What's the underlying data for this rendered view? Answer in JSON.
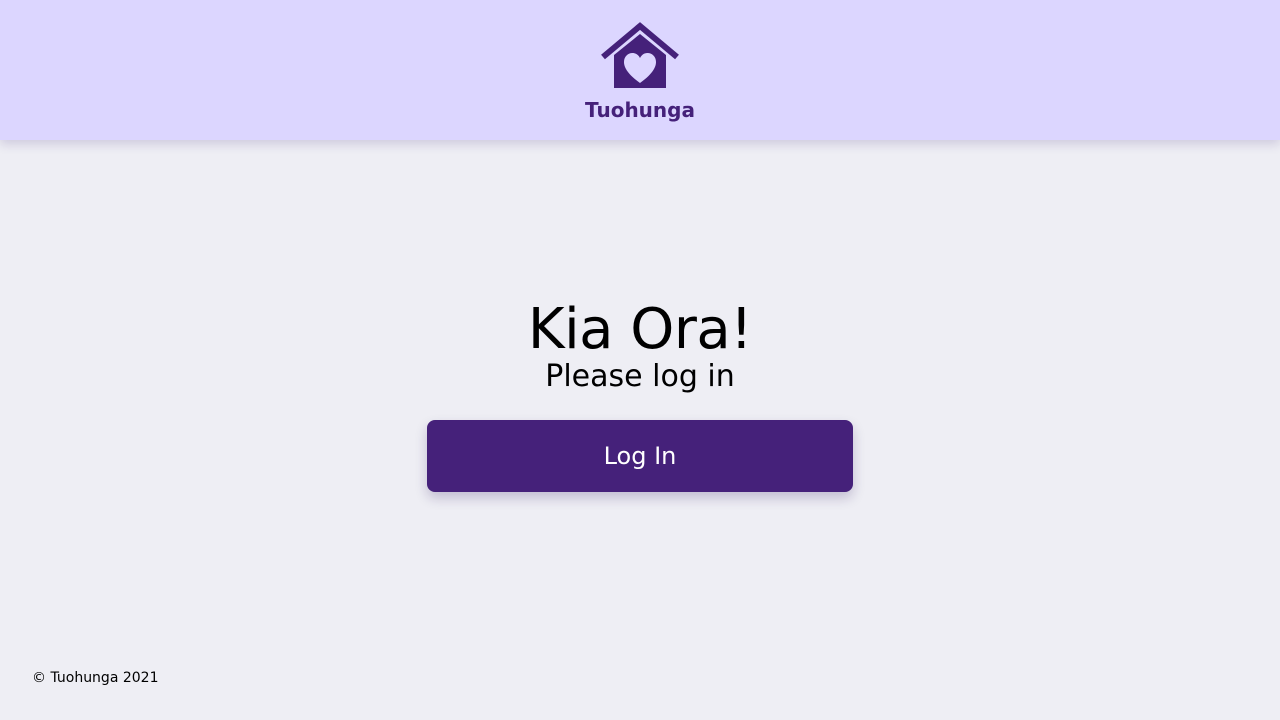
{
  "header": {
    "logo_icon": "house-heart-icon",
    "brand_name": "Tuohunga"
  },
  "hero": {
    "title": "Kia Ora!",
    "subtitle": "Please log in"
  },
  "actions": {
    "login_label": "Log In"
  },
  "footer": {
    "copyright": "© Tuohunga 2021"
  },
  "colors": {
    "header_bg": "#dcd6ff",
    "page_bg": "#eeeef4",
    "brand": "#45217a",
    "button_text": "#ffffff"
  }
}
